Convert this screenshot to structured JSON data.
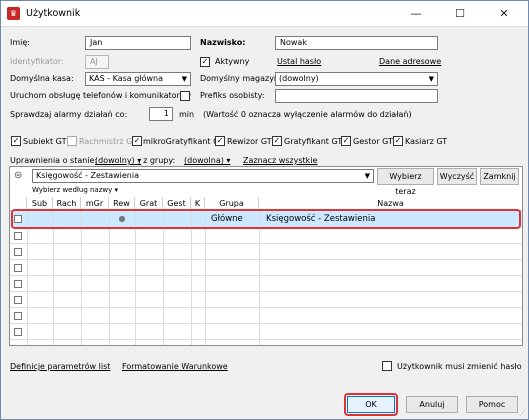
{
  "window": {
    "title": "Użytkownik",
    "minimize": "—",
    "maximize": "☐",
    "close": "✕"
  },
  "form": {
    "imie_label": "Imię:",
    "imie_value": "Jan",
    "nazwisko_label": "Nazwisko:",
    "nazwisko_value": "Nowak",
    "identyfikator_label": "Identyfikator:",
    "identyfikator_value": "AJ",
    "aktywny_label": "Aktywny",
    "ustal_haslo": "Ustal hasło",
    "dane_adresowe": "Dane adresowe",
    "kasa_label": "Domyślna kasa:",
    "kasa_value": "KAS - Kasa główna",
    "magazyn_label": "Domyślny magazyn:",
    "magazyn_value": "(dowolny)",
    "telefon_label": "Uruchom obsługę telefonów i komunikatorów",
    "prefiks_label": "Prefiks osobisty:",
    "prefiks_value": "",
    "alarm_label": "Sprawdzaj alarmy działań co:",
    "alarm_value": "1",
    "alarm_unit": "min",
    "alarm_note": "(Wartość 0 oznacza wyłączenie alarmów do działań)"
  },
  "modules": [
    {
      "label": "Subiekt GT",
      "checked": "✓",
      "enabled": true
    },
    {
      "label": "Rachmistrz GT",
      "checked": "",
      "enabled": false
    },
    {
      "label": "mikroGratyfikant GT",
      "checked": "✓",
      "enabled": true
    },
    {
      "label": "Rewizor GT",
      "checked": "✓",
      "enabled": true
    },
    {
      "label": "Gratyfikant GT",
      "checked": "✓",
      "enabled": true
    },
    {
      "label": "Gestor GT",
      "checked": "✓",
      "enabled": true
    },
    {
      "label": "Kasiarz GT",
      "checked": "✓",
      "enabled": true
    }
  ],
  "permissions": {
    "label": "Uprawnienia o stanie:",
    "state_value": "(dowolny)",
    "group_label": ", z grupy:",
    "group_value": "(dowolna)",
    "select_all": "Zaznacz wszystkie",
    "filter_value": "Księgowość - Zestawienia",
    "choose_now": "Wybierz teraz",
    "clear": "Wyczyść",
    "close": "Zamknij",
    "choose_by_name": "Wybierz według nazwy"
  },
  "table": {
    "columns": [
      "Sub",
      "Rach",
      "mGr",
      "Rew",
      "Grat",
      "Gest",
      "K",
      "Grupa",
      "Nazwa"
    ],
    "rows": [
      {
        "rew": "●",
        "grupa": "Główne",
        "nazwa": "Księgowość - Zestawienia"
      }
    ]
  },
  "footer": {
    "definicje": "Definicje parametrów list",
    "formatowanie": "Formatowanie Warunkowe",
    "musi_zmienic": "Użytkownik musi zmienić hasło",
    "ok": "OK",
    "anuluj": "Anuluj",
    "pomoc": "Pomoc"
  }
}
